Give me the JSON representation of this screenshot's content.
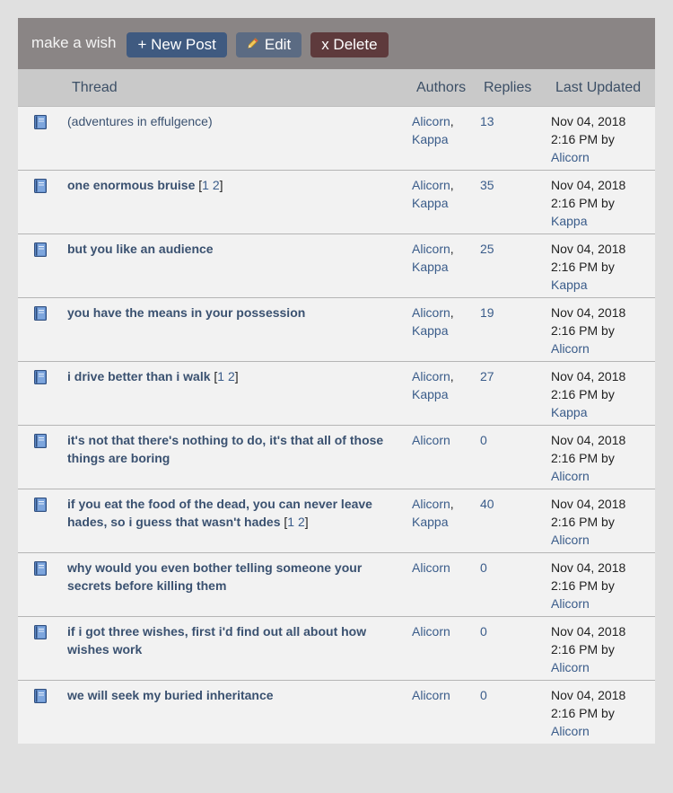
{
  "toolbar": {
    "title": "make a wish",
    "new_post_label": "+ New Post",
    "edit_label": "Edit",
    "delete_label": "x Delete"
  },
  "colors": {
    "topbar": "#8a8585",
    "header": "#c9c9c9",
    "new_post": "#3f5a80",
    "edit": "#5b6b83",
    "delete": "#5e3a3c",
    "link": "#3a5c8a"
  },
  "columns": {
    "thread": "Thread",
    "authors": "Authors",
    "replies": "Replies",
    "last_updated": "Last Updated"
  },
  "threads": [
    {
      "icon": "thread-book-icon",
      "title_lines": [
        "(adventures in effulgence)"
      ],
      "bold": false,
      "pages": [],
      "authors": [
        "Alicorn",
        "Kappa"
      ],
      "replies": "13",
      "updated_date": "Nov 04, 2018",
      "updated_time": "2:16 PM by",
      "updated_by": "Alicorn"
    },
    {
      "icon": "thread-book-icon",
      "title_lines": [
        "one enormous bruise"
      ],
      "bold": true,
      "pages": [
        "1",
        "2"
      ],
      "authors": [
        "Alicorn",
        "Kappa"
      ],
      "replies": "35",
      "updated_date": "Nov 04, 2018",
      "updated_time": "2:16 PM by",
      "updated_by": "Kappa"
    },
    {
      "icon": "thread-book-icon",
      "title_lines": [
        "but you like an audience"
      ],
      "bold": true,
      "pages": [],
      "authors": [
        "Alicorn",
        "Kappa"
      ],
      "replies": "25",
      "updated_date": "Nov 04, 2018",
      "updated_time": "2:16 PM by",
      "updated_by": "Kappa"
    },
    {
      "icon": "thread-book-icon",
      "title_lines": [
        "you have the means in your possession"
      ],
      "bold": true,
      "pages": [],
      "authors": [
        "Alicorn",
        "Kappa"
      ],
      "replies": "19",
      "updated_date": "Nov 04, 2018",
      "updated_time": "2:16 PM by",
      "updated_by": "Alicorn"
    },
    {
      "icon": "thread-book-icon",
      "title_lines": [
        "i drive better than i walk"
      ],
      "bold": true,
      "pages": [
        "1",
        "2"
      ],
      "authors": [
        "Alicorn",
        "Kappa"
      ],
      "replies": "27",
      "updated_date": "Nov 04, 2018",
      "updated_time": "2:16 PM by",
      "updated_by": "Kappa"
    },
    {
      "icon": "thread-book-icon",
      "title_lines": [
        "it's not that there's nothing to do, it's that all of those",
        "things are boring"
      ],
      "bold": true,
      "pages": [],
      "authors": [
        "Alicorn"
      ],
      "replies": "0",
      "updated_date": "Nov 04, 2018",
      "updated_time": "2:16 PM by",
      "updated_by": "Alicorn"
    },
    {
      "icon": "thread-book-icon",
      "title_lines": [
        "if you eat the food of the dead, you can never leave",
        "hades, so i guess that wasn't hades"
      ],
      "bold": true,
      "pages": [
        "1",
        "2"
      ],
      "authors": [
        "Alicorn",
        "Kappa"
      ],
      "replies": "40",
      "updated_date": "Nov 04, 2018",
      "updated_time": "2:16 PM by",
      "updated_by": "Alicorn"
    },
    {
      "icon": "thread-book-icon",
      "title_lines": [
        "why would you even bother telling someone your",
        "secrets before killing them"
      ],
      "bold": true,
      "pages": [],
      "authors": [
        "Alicorn"
      ],
      "replies": "0",
      "updated_date": "Nov 04, 2018",
      "updated_time": "2:16 PM by",
      "updated_by": "Alicorn"
    },
    {
      "icon": "thread-book-icon",
      "title_lines": [
        "if i got three wishes, first i'd find out all about how",
        "wishes work"
      ],
      "bold": true,
      "pages": [],
      "authors": [
        "Alicorn"
      ],
      "replies": "0",
      "updated_date": "Nov 04, 2018",
      "updated_time": "2:16 PM by",
      "updated_by": "Alicorn"
    },
    {
      "icon": "thread-book-icon",
      "title_lines": [
        "we will seek my buried inheritance"
      ],
      "bold": true,
      "pages": [],
      "authors": [
        "Alicorn"
      ],
      "replies": "0",
      "updated_date": "Nov 04, 2018",
      "updated_time": "2:16 PM by",
      "updated_by": "Alicorn"
    }
  ]
}
